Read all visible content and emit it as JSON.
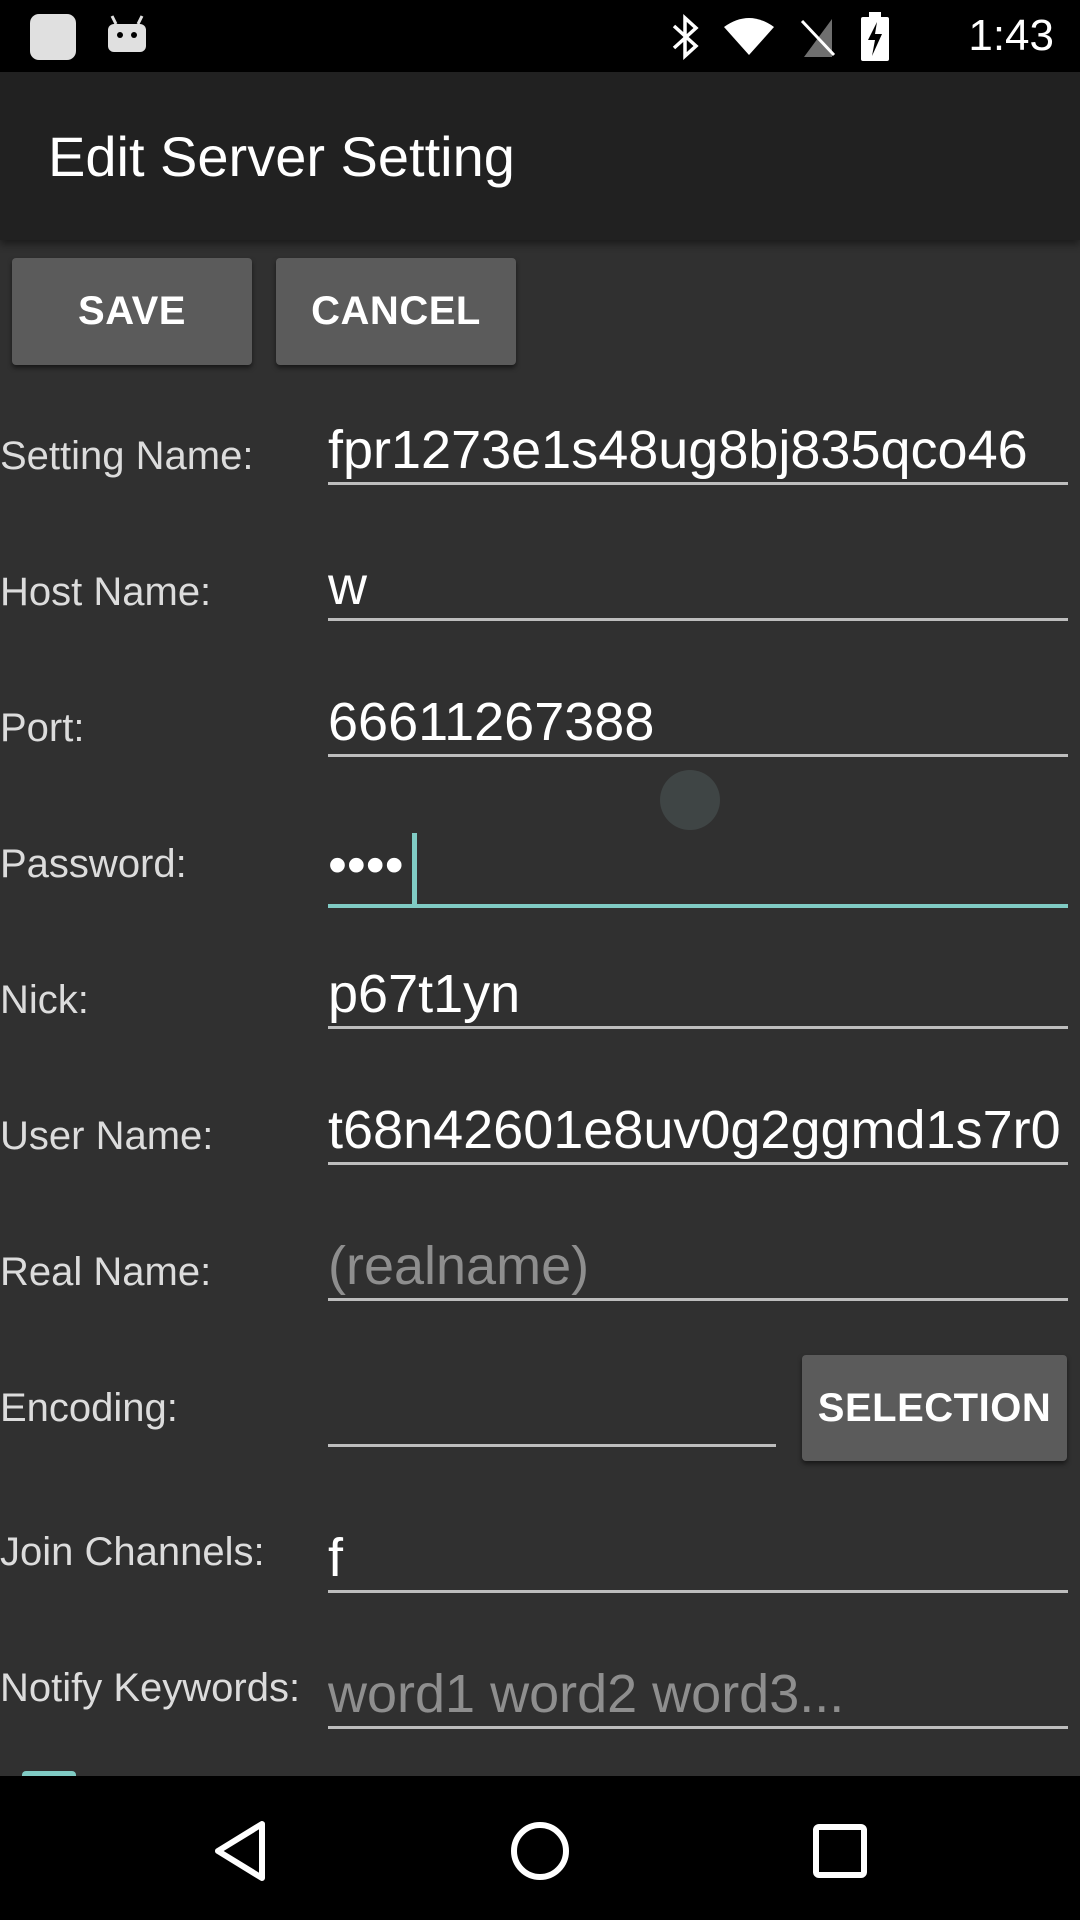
{
  "status_bar": {
    "time": "1:43",
    "icons": [
      "notification-icon",
      "android-icon",
      "bluetooth-icon",
      "wifi-icon",
      "no-sim-icon",
      "battery-charging-icon"
    ]
  },
  "app_bar": {
    "title": "Edit Server Setting"
  },
  "toolbar": {
    "save_label": "SAVE",
    "cancel_label": "CANCEL"
  },
  "form": {
    "setting_name": {
      "label": "Setting Name:",
      "value": "fpr1273e1s48ug8bj835qco46"
    },
    "host_name": {
      "label": "Host Name:",
      "value": "w"
    },
    "port": {
      "label": "Port:",
      "value": "66611267388"
    },
    "password": {
      "label": "Password:",
      "value": "••••"
    },
    "nick": {
      "label": "Nick:",
      "value": "p67t1yn"
    },
    "user_name": {
      "label": "User Name:",
      "value": "t68n42601e8uv0g2ggmd1s7r0"
    },
    "real_name": {
      "label": "Real Name:",
      "placeholder": "(realname)"
    },
    "encoding": {
      "label": "Encoding:",
      "value": "",
      "selection_label": "SELECTION"
    },
    "join_channels": {
      "label": "Join Channels:",
      "value": "f"
    },
    "notify_keywords": {
      "label": "Notify Keywords:",
      "placeholder": "word1 word2 word3..."
    }
  },
  "colors": {
    "accent": "#80cbc4",
    "background": "#303030",
    "app_bar": "#212121",
    "button": "#5b5b5b"
  },
  "nav_bar": {
    "icons": [
      "back-icon",
      "home-icon",
      "recents-icon"
    ]
  }
}
